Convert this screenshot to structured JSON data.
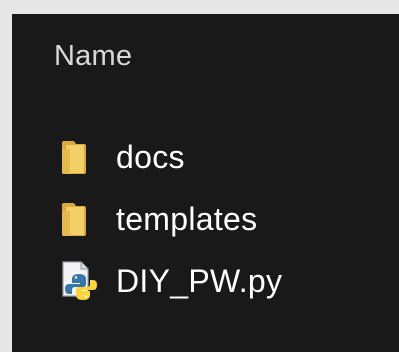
{
  "explorer": {
    "column_header": "Name",
    "items": [
      {
        "name": "docs",
        "icon": "folder-icon",
        "type": "folder"
      },
      {
        "name": "templates",
        "icon": "folder-icon",
        "type": "folder"
      },
      {
        "name": "DIY_PW.py",
        "icon": "python-file-icon",
        "type": "file"
      }
    ]
  },
  "colors": {
    "background": "#191919",
    "outer_border": "#e6e6e6",
    "text": "#ffffff",
    "header_text": "#d8d8d8",
    "folder": "#e9c46a"
  }
}
